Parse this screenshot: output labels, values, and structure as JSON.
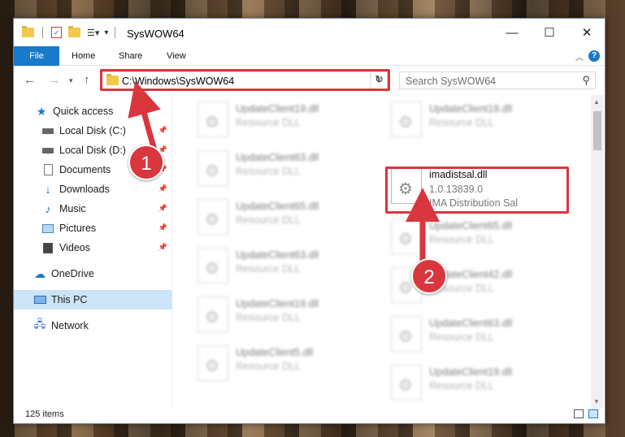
{
  "window": {
    "title": "SysWOW64",
    "minimize_icon": "minimize-icon",
    "maximize_icon": "maximize-icon",
    "close_icon": "close-icon"
  },
  "ribbon": {
    "tabs": [
      {
        "label": "File"
      },
      {
        "label": "Home"
      },
      {
        "label": "Share"
      },
      {
        "label": "View"
      }
    ],
    "help_label": "?"
  },
  "address": {
    "path": "C:\\Windows\\SysWOW64",
    "search_placeholder": "Search SysWOW64"
  },
  "nav_pane": {
    "items": [
      {
        "label": "Quick access",
        "icon": "star-icon"
      },
      {
        "label": "Local Disk (C:)",
        "icon": "drive-icon",
        "pinned": true
      },
      {
        "label": "Local Disk (D:)",
        "icon": "drive-icon",
        "pinned": true
      },
      {
        "label": "Documents",
        "icon": "documents-icon",
        "pinned": true
      },
      {
        "label": "Downloads",
        "icon": "download-icon",
        "pinned": true
      },
      {
        "label": "Music",
        "icon": "music-icon",
        "pinned": true
      },
      {
        "label": "Pictures",
        "icon": "pictures-icon",
        "pinned": true
      },
      {
        "label": "Videos",
        "icon": "videos-icon",
        "pinned": true
      },
      {
        "label": "OneDrive",
        "icon": "cloud-icon"
      },
      {
        "label": "This PC",
        "icon": "computer-icon",
        "selected": true
      },
      {
        "label": "Network",
        "icon": "network-icon"
      }
    ]
  },
  "files": {
    "left_column": [
      {
        "name": "UpdateClient19.dll",
        "type": "Resource DLL"
      },
      {
        "name": "UpdateClient63.dll",
        "type": "Resource DLL"
      },
      {
        "name": "UpdateClient65.dll",
        "type": "Resource DLL"
      },
      {
        "name": "UpdateClient63.dll",
        "type": "Resource DLL"
      },
      {
        "name": "UpdateClient19.dll",
        "type": "Resource DLL"
      },
      {
        "name": "UpdateClient5.dll",
        "type": "Resource DLL"
      }
    ],
    "right_column": [
      {
        "name": "UpdateClient19.dll",
        "type": "Resource DLL"
      },
      {
        "name": "imadistsal.dll",
        "version": "1.0.13839.0",
        "type": "IMA Distribution Sal",
        "highlighted": true
      },
      {
        "name": "UpdateClient65.dll",
        "type": "Resource DLL"
      },
      {
        "name": "UpdateClient42.dll",
        "type": "Resource DLL"
      },
      {
        "name": "UpdateClient63.dll",
        "type": "Resource DLL"
      },
      {
        "name": "UpdateClient19.dll",
        "type": "Resource DLL"
      }
    ]
  },
  "status": {
    "item_count": "125 items"
  },
  "annotations": {
    "step1": "1",
    "step2": "2",
    "color": "#d9363e"
  }
}
